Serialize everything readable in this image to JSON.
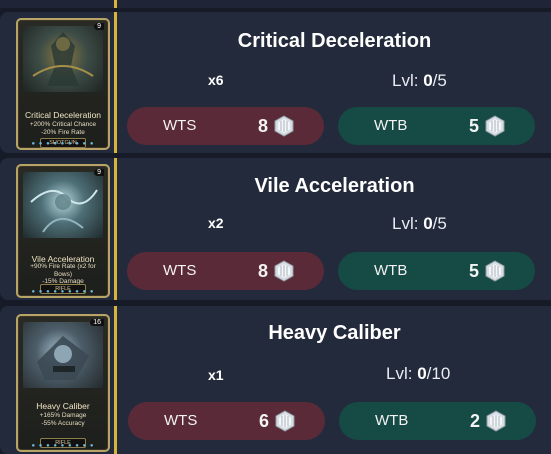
{
  "listings": [
    {
      "title": "Critical Deceleration",
      "quantity": "x6",
      "level_prefix": "Lvl: ",
      "level_current": "0",
      "level_max": "/5",
      "wts_label": "WTS",
      "wts_price": "8",
      "wtb_label": "WTB",
      "wtb_price": "5",
      "card": {
        "rank": "9",
        "name": "Critical Deceleration",
        "desc": "+200% Critical Chance\n-20% Fire Rate",
        "type": "SHOTGUN"
      }
    },
    {
      "title": "Vile Acceleration",
      "quantity": "x2",
      "level_prefix": "Lvl: ",
      "level_current": "0",
      "level_max": "/5",
      "wts_label": "WTS",
      "wts_price": "8",
      "wtb_label": "WTB",
      "wtb_price": "5",
      "card": {
        "rank": "9",
        "name": "Vile Acceleration",
        "desc": "+90% Fire Rate (x2 for Bows)\n-15% Damage",
        "type": "RIFLE"
      }
    },
    {
      "title": "Heavy Caliber",
      "quantity": "x1",
      "level_prefix": "Lvl: ",
      "level_current": "0",
      "level_max": "/10",
      "wts_label": "WTS",
      "wts_price": "6",
      "wtb_label": "WTB",
      "wtb_price": "2",
      "card": {
        "rank": "16",
        "name": "Heavy Caliber",
        "desc": "+165% Damage\n-55% Accuracy",
        "type": "RIFLE"
      }
    }
  ],
  "icons": {
    "currency": "platinum-icon"
  },
  "colors": {
    "accent_gold": "#d9b43a",
    "wts_bg": "#5a2a38",
    "wtb_bg": "#164a45",
    "row_bg": "#232a3b",
    "page_bg": "#161b27"
  }
}
